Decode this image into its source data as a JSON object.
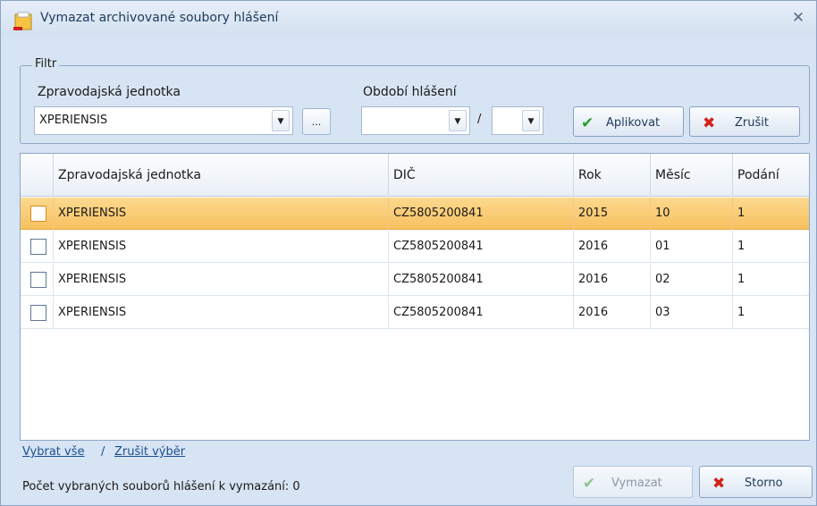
{
  "window": {
    "title": "Vymazat archivované soubory hlášení",
    "close_glyph": "✕"
  },
  "filter": {
    "legend": "Filtr",
    "unit_label": "Zpravodajská jednotka",
    "unit_value": "XPERIENSIS",
    "browse_label": "...",
    "period_label": "Období hlášení",
    "year_value": "",
    "month_value": "",
    "separator": "/",
    "apply_label": "Aplikovat",
    "cancel_label": "Zrušit"
  },
  "grid": {
    "columns": [
      "Zpravodajská jednotka",
      "DIČ",
      "Rok",
      "Měsíc",
      "Podání"
    ],
    "rows": [
      {
        "unit": "XPERIENSIS",
        "dic": "CZ5805200841",
        "year": "2015",
        "month": "10",
        "submission": "1",
        "checked": false
      },
      {
        "unit": "XPERIENSIS",
        "dic": "CZ5805200841",
        "year": "2016",
        "month": "01",
        "submission": "1",
        "checked": false
      },
      {
        "unit": "XPERIENSIS",
        "dic": "CZ5805200841",
        "year": "2016",
        "month": "02",
        "submission": "1",
        "checked": false
      },
      {
        "unit": "XPERIENSIS",
        "dic": "CZ5805200841",
        "year": "2016",
        "month": "03",
        "submission": "1",
        "checked": false
      }
    ]
  },
  "footer": {
    "select_all": "Vybrat vše",
    "link_separator": "/",
    "clear_selection": "Zrušit výběr",
    "count_text": "Počet vybraných souborů hlášení k vymazání: 0",
    "delete_label": "Vymazat",
    "storno_label": "Storno"
  },
  "colors": {
    "window_bg": "#d7e4f3",
    "selected_row": "#f8c160",
    "ok_green": "#2e9e2e",
    "cancel_red": "#d0231b",
    "link": "#1d4f91"
  },
  "icons": {
    "window": "report-folder-icon",
    "close": "close-icon",
    "apply": "checkmark-icon",
    "cancel": "red-x-icon"
  }
}
